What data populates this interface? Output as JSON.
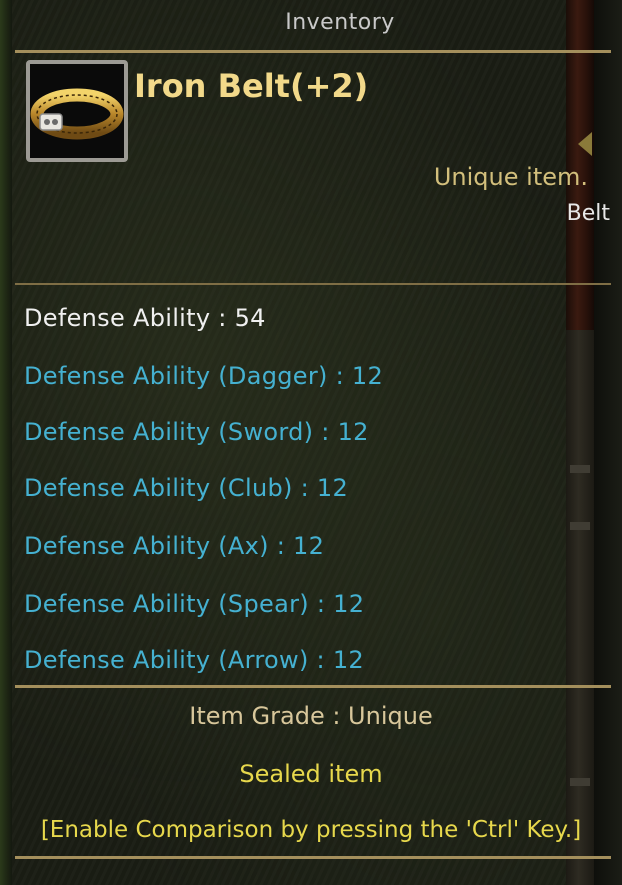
{
  "window": {
    "title": "Inventory"
  },
  "item": {
    "name": "Iron Belt(+2)",
    "icon": "gold-belt-icon",
    "rarity_text": "Unique item.",
    "type": "Belt"
  },
  "stats": {
    "base": "Defense Ability : 54",
    "sub": [
      "Defense Ability (Dagger) : 12",
      "Defense Ability (Sword) : 12",
      "Defense Ability (Club) : 12",
      "Defense Ability (Ax) : 12",
      "Defense Ability (Spear) : 12",
      "Defense Ability (Arrow) : 12"
    ]
  },
  "footer": {
    "grade": "Item Grade : Unique",
    "sealed": "Sealed item",
    "compare_hint": "[Enable Comparison by pressing the 'Ctrl' Key.]"
  },
  "colors": {
    "name": "#f2d98a",
    "base_stat": "#f0f0f0",
    "sub_stat": "#45b1d1",
    "sealed": "#e7d84c",
    "separator": "#a48f5c"
  }
}
